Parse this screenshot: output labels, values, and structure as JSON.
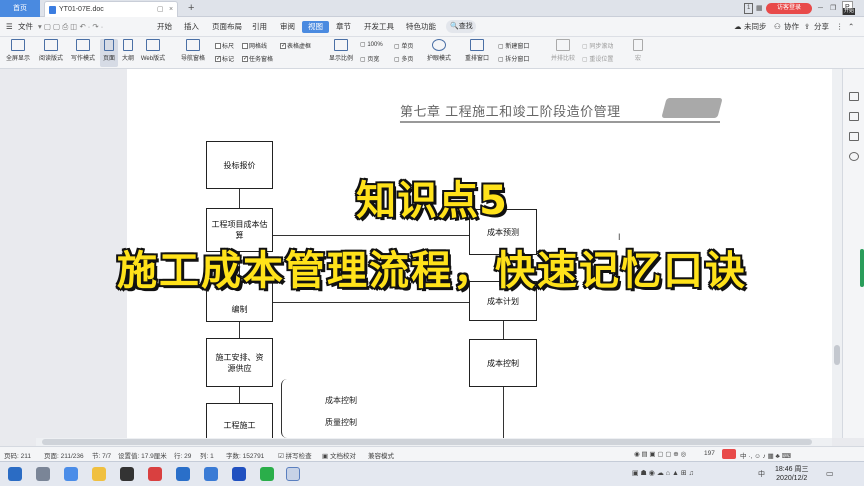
{
  "tabs": {
    "home": "首页",
    "document": "YT01-07E.doc",
    "new_tab": "+"
  },
  "titlebar": {
    "page_indicator": "1",
    "login": "访客登录",
    "right_icon_text": "P",
    "start_label": "开始"
  },
  "menu": {
    "file": "文件",
    "items": [
      "开始",
      "插入",
      "页面布局",
      "引用",
      "审阅",
      "视图",
      "章节",
      "开发工具",
      "特色功能"
    ],
    "active": "视图",
    "search": "查找",
    "sync": "未同步",
    "collab": "协作",
    "share": "分享"
  },
  "toolbar": {
    "buttons": [
      "全屏显示",
      "阅读版式",
      "写作模式",
      "页面",
      "大纲",
      "Web版式",
      "导航窗格"
    ],
    "checks": [
      {
        "label": "标尺",
        "checked": false
      },
      {
        "label": "网格线",
        "checked": false
      },
      {
        "label": "表格虚框",
        "checked": true
      },
      {
        "label": "标记",
        "checked": true
      },
      {
        "label": "任务窗格",
        "checked": true
      }
    ],
    "zoom_group": [
      "显示比例",
      "100%",
      "页宽",
      "单页",
      "多页"
    ],
    "eye": "护眼模式",
    "window_group": [
      "重排窗口",
      "新建窗口",
      "拆分窗口",
      "并排比较",
      "同步滚动",
      "重设位置"
    ],
    "macro": "宏"
  },
  "document": {
    "chapter_title": "第七章   工程施工和竣工阶段造价管理",
    "flow_left": [
      "投标报价",
      "工程项目成本估算",
      "编制",
      "施工安排、资源供应",
      "工程施工"
    ],
    "flow_right": [
      "成本预测",
      "成本计划",
      "成本控制"
    ],
    "brace_items": [
      "成本控制",
      "质量控制"
    ]
  },
  "overlay": {
    "title": "知识点5",
    "subtitle": "施工成本管理流程，快速记忆口诀"
  },
  "statusbar": {
    "page": "页码: 211",
    "pages": "页面: 211/236",
    "section": "节: 7/7",
    "setting": "设置值: 17.9厘米",
    "row": "行: 29",
    "col": "列: 1",
    "words": "字数: 152791",
    "spell": "拼写检查",
    "proof": "文档校对",
    "compat": "兼容模式",
    "zoom": "197"
  },
  "taskbar": {
    "time": "18:46 周三",
    "date": "2020/12/2",
    "ime": "中"
  }
}
